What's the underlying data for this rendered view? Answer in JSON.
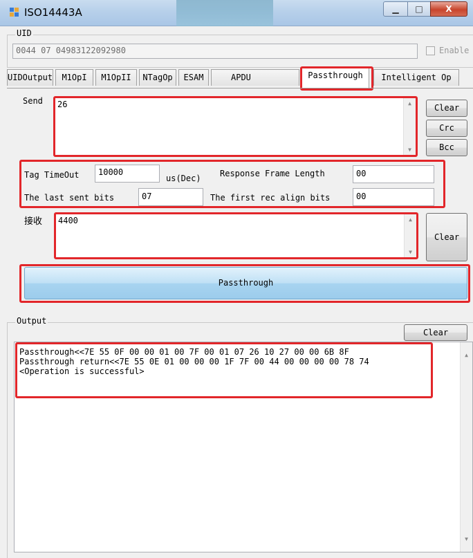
{
  "window": {
    "title": "ISO14443A",
    "min_label": "▁",
    "max_label": "□",
    "close_label": "X"
  },
  "uid": {
    "group_label": "UID",
    "value": "0044 07 04983122092980",
    "enable_label": "Enable"
  },
  "tabs": [
    {
      "label": "UIDOutput"
    },
    {
      "label": "M1OpI"
    },
    {
      "label": "M1OpII"
    },
    {
      "label": "NTagOp"
    },
    {
      "label": "ESAM"
    },
    {
      "label": "APDU"
    },
    {
      "label": "Passthrough"
    },
    {
      "label": "Intelligent Op"
    }
  ],
  "passthrough": {
    "send_label": "Send",
    "send_value": "26",
    "clear_label": "Clear",
    "crc_label": "Crc",
    "bcc_label": "Bcc",
    "tag_timeout_label": "Tag TimeOut",
    "tag_timeout_value": "10000",
    "unit_label": "us(Dec)",
    "response_frame_length_label": "Response Frame Length",
    "response_frame_length_value": "00",
    "last_sent_bits_label": "The last sent bits",
    "last_sent_bits_value": "07",
    "first_rec_align_label": "The first rec align bits",
    "first_rec_align_value": "00",
    "receive_label": "接收",
    "receive_value": "4400",
    "receive_clear_label": "Clear",
    "passthrough_button_label": "Passthrough"
  },
  "output": {
    "group_label": "Output",
    "clear_label": "Clear",
    "lines": [
      "Passthrough<<7E 55 0F 00 00 01 00 7F 00 01 07 26 10 27 00 00 6B 8F",
      "Passthrough return<<7E 55 0E 01 00 00 00 1F 7F 00 44 00 00 00 00 78 74",
      "<Operation is successful>"
    ]
  },
  "colors": {
    "highlight": "#e2262a",
    "passthrough_button": "#bfe0f5",
    "titlebar": "#b7d0ea"
  }
}
